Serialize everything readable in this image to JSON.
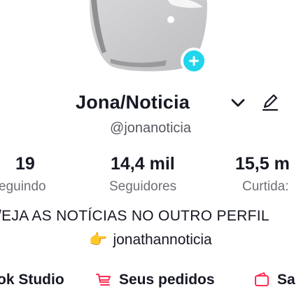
{
  "profile": {
    "display_name": "Jona/Noticia",
    "handle": "@jonanoticia"
  },
  "stats": [
    {
      "value": "19",
      "label": "eguindo"
    },
    {
      "value": "14,4 mil",
      "label": "Seguidores"
    },
    {
      "value": "15,5 m",
      "label": "Curtida:"
    }
  ],
  "bio": {
    "line1": "/EJA AS NOTÍCIAS NO OUTRO PERFIL",
    "hand_glyph": "👉",
    "line2": "jonathannoticia"
  },
  "quick_links": [
    {
      "label": "ok Studio",
      "icon": "studio-icon"
    },
    {
      "label": "Seus pedidos",
      "icon": "cart-icon"
    },
    {
      "label": "Sa",
      "icon": "wallet-icon"
    }
  ],
  "colors": {
    "accent_badge": "#20d5ec",
    "cart_icon": "#fe2c55",
    "wallet_icon": "#fe2c55",
    "text_primary": "#161823",
    "text_secondary": "#6e6f76"
  }
}
